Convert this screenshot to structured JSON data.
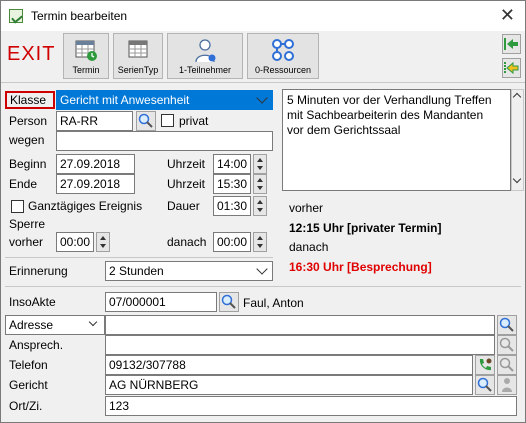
{
  "window": {
    "title": "Termin bearbeiten",
    "close": "✕"
  },
  "toolbar": {
    "exit_label": "EXIT",
    "termin_label": "Termin",
    "serientyp_label": "SerienTyp",
    "teilnehmer_label": "1-Teilnehmer",
    "ressourcen_label": "0-Ressourcen"
  },
  "form": {
    "klasse_label": "Klasse",
    "klasse_value": "Gericht mit Anwesenheit",
    "person_label": "Person",
    "person_value": "RA-RR",
    "privat_label": "privat",
    "wegen_label": "wegen",
    "wegen_value": "",
    "beginn_label": "Beginn",
    "beginn_date": "27.09.2018",
    "ende_label": "Ende",
    "ende_date": "27.09.2018",
    "uhrzeit1_label": "Uhrzeit",
    "uhrzeit1_value": "14:00",
    "uhrzeit2_label": "Uhrzeit",
    "uhrzeit2_value": "15:30",
    "ganztag_label": "Ganztägiges Ereignis",
    "dauer_label": "Dauer",
    "dauer_value": "01:30",
    "sperre_label": "Sperre",
    "vorher_label": "vorher",
    "vorher_value": "00:00",
    "danach_label": "danach",
    "danach_value": "00:00",
    "erinnerung_label": "Erinnerung",
    "erinnerung_value": "2 Stunden"
  },
  "notes": {
    "line1": "5 Minuten vor der Verhandlung Treffen",
    "line2": "mit Sachbearbeiterin des Mandanten",
    "line3": "vor dem Gerichtssaal"
  },
  "conflicts": {
    "vorher_label": "vorher",
    "vorher_entry": "12:15 Uhr [privater Termin]",
    "danach_label": "danach",
    "danach_entry": "16:30 Uhr [Besprechung]"
  },
  "case": {
    "insoakte_label": "InsoAkte",
    "insoakte_value": "07/000001",
    "insoakte_name": "Faul, Anton",
    "adresse_label": "Adresse",
    "adresse_value": "",
    "ansprech_label": "Ansprech.",
    "ansprech_value": "",
    "telefon_label": "Telefon",
    "telefon_value": "09132/307788",
    "gericht_label": "Gericht",
    "gericht_value": "AG NÜRNBERG",
    "ort_label": "Ort/Zi.",
    "ort_value": "123"
  },
  "colors": {
    "accent_select": "#0078d7",
    "klasse_border": "#d00000",
    "danger_text": "#e00000"
  }
}
